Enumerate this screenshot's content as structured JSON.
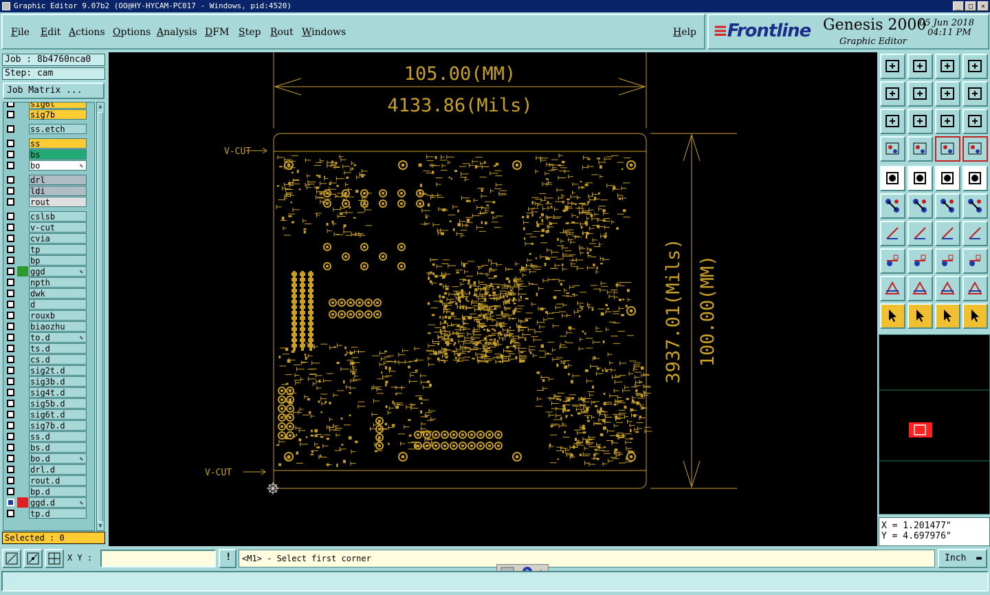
{
  "window": {
    "title": "Graphic Editor 9.07b2 (OO@HY-HYCAM-PC017 - Windows, pid:4520)",
    "controls": [
      "_",
      "□",
      "×"
    ]
  },
  "menu": [
    "File",
    "Edit",
    "Actions",
    "Options",
    "Analysis",
    "DFM",
    "Step",
    "Rout",
    "Windows"
  ],
  "help_label": "Help",
  "brand": {
    "logo": "Frontline",
    "product": "Genesis 2000",
    "subtitle": "Graphic Editor",
    "date": "05 Jun 2018",
    "time": "04:11 PM"
  },
  "job": {
    "job_label": "Job : 8b4760nca0",
    "step_label": "Step: cam",
    "matrix_button": "Job Matrix ..."
  },
  "layers": [
    {
      "name": "sig6t",
      "color": "#ffcc33",
      "swatch": "",
      "affected": ""
    },
    {
      "name": "sig7b",
      "color": "#ffcc33",
      "swatch": "",
      "affected": ""
    },
    {
      "name": "ss.etch",
      "color": "#a8d8d8",
      "swatch": "",
      "affected": ""
    },
    {
      "name": "ss",
      "color": "#ffcc33",
      "swatch": "",
      "affected": ""
    },
    {
      "name": "bs",
      "color": "#22aa77",
      "swatch": "",
      "affected": ""
    },
    {
      "name": "bo",
      "color": "#ffffff",
      "swatch": "",
      "affected": "✎"
    },
    {
      "name": "drl",
      "color": "#b0bcc4",
      "swatch": "",
      "affected": ""
    },
    {
      "name": "ldi",
      "color": "#b0bcc4",
      "swatch": "",
      "affected": ""
    },
    {
      "name": "rout",
      "color": "#e0e0e0",
      "swatch": "",
      "affected": ""
    },
    {
      "name": "cslsb",
      "color": "#a8d8d8",
      "swatch": "",
      "affected": ""
    },
    {
      "name": "v-cut",
      "color": "#a8d8d8",
      "swatch": "",
      "affected": ""
    },
    {
      "name": "cvia",
      "color": "#a8d8d8",
      "swatch": "",
      "affected": ""
    },
    {
      "name": "tp",
      "color": "#a8d8d8",
      "swatch": "",
      "affected": ""
    },
    {
      "name": "bp",
      "color": "#a8d8d8",
      "swatch": "",
      "affected": ""
    },
    {
      "name": "ggd",
      "color": "#a8d8d8",
      "swatch": "#2e9a2e",
      "affected": "✎"
    },
    {
      "name": "npth",
      "color": "#a8d8d8",
      "swatch": "",
      "affected": ""
    },
    {
      "name": "dwk",
      "color": "#a8d8d8",
      "swatch": "",
      "affected": ""
    },
    {
      "name": "d",
      "color": "#a8d8d8",
      "swatch": "",
      "affected": ""
    },
    {
      "name": "rouxb",
      "color": "#a8d8d8",
      "swatch": "",
      "affected": ""
    },
    {
      "name": "biaozhu",
      "color": "#a8d8d8",
      "swatch": "",
      "affected": ""
    },
    {
      "name": "to.d",
      "color": "#a8d8d8",
      "swatch": "",
      "affected": "✎"
    },
    {
      "name": "ts.d",
      "color": "#a8d8d8",
      "swatch": "",
      "affected": ""
    },
    {
      "name": "cs.d",
      "color": "#a8d8d8",
      "swatch": "",
      "affected": ""
    },
    {
      "name": "sig2t.d",
      "color": "#a8d8d8",
      "swatch": "",
      "affected": ""
    },
    {
      "name": "sig3b.d",
      "color": "#a8d8d8",
      "swatch": "",
      "affected": ""
    },
    {
      "name": "sig4t.d",
      "color": "#a8d8d8",
      "swatch": "",
      "affected": ""
    },
    {
      "name": "sig5b.d",
      "color": "#a8d8d8",
      "swatch": "",
      "affected": ""
    },
    {
      "name": "sig6t.d",
      "color": "#a8d8d8",
      "swatch": "",
      "affected": ""
    },
    {
      "name": "sig7b.d",
      "color": "#a8d8d8",
      "swatch": "",
      "affected": ""
    },
    {
      "name": "ss.d",
      "color": "#a8d8d8",
      "swatch": "",
      "affected": ""
    },
    {
      "name": "bs.d",
      "color": "#a8d8d8",
      "swatch": "",
      "affected": ""
    },
    {
      "name": "bo.d",
      "color": "#a8d8d8",
      "swatch": "",
      "affected": "✎"
    },
    {
      "name": "drl.d",
      "color": "#a8d8d8",
      "swatch": "",
      "affected": ""
    },
    {
      "name": "rout.d",
      "color": "#a8d8d8",
      "swatch": "",
      "affected": ""
    },
    {
      "name": "bp.d",
      "color": "#a8d8d8",
      "swatch": "",
      "affected": ""
    },
    {
      "name": "ggd.d",
      "color": "#a8d8d8",
      "swatch": "#e02020",
      "affected": "✎"
    },
    {
      "name": "tp.d",
      "color": "#a8d8d8",
      "swatch": "",
      "affected": ""
    }
  ],
  "selected_label": "Selected : 0",
  "drawing": {
    "width_mm": "105.00(MM)",
    "width_mils": "4133.86(Mils)",
    "height_mils": "3937.01(Mils)",
    "height_mm": "100.00(MM)",
    "vcut_top": "V-CUT",
    "vcut_bottom": "V-CUT",
    "trace_color": "#c8a028"
  },
  "coords": {
    "x": "X = 1.201477\"",
    "y": "Y = 4.697976\""
  },
  "bottom": {
    "xy_label": "X Y :",
    "xy_value": "",
    "prompt": "<M1> - Select first corner",
    "units": "Inch",
    "warn_icon": "!"
  }
}
